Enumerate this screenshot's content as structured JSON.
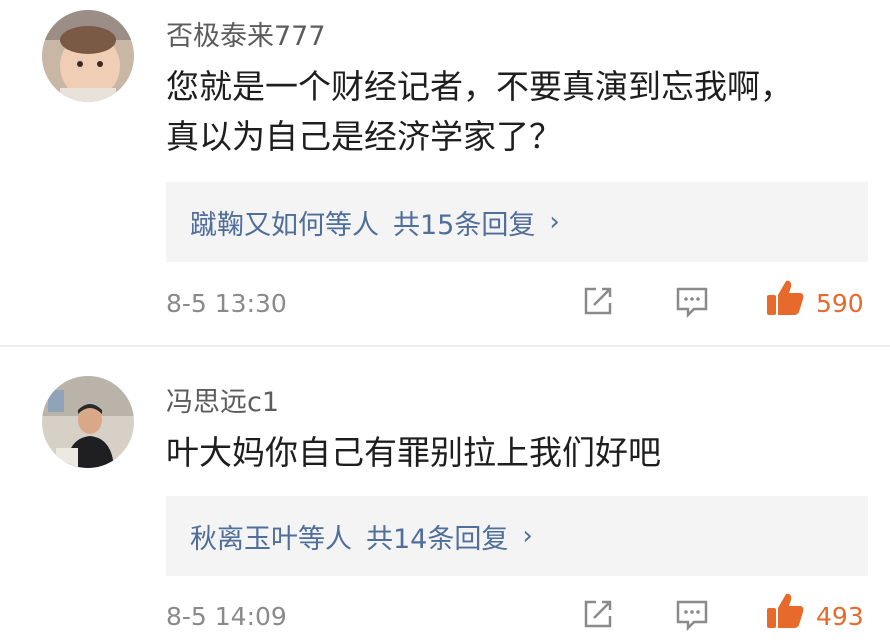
{
  "comments": [
    {
      "username": "否极泰来777",
      "text_line1": "您就是一个财经记者，不要真演到忘我啊，",
      "text_line2": "真以为自己是经济学家了？",
      "reply_names": "蹴鞠又如何等人",
      "reply_count": "共15条回复",
      "chevron": "›",
      "time": "8-5 13:30",
      "likes": "590"
    },
    {
      "username": "冯思远c1",
      "text_line1": "叶大妈你自己有罪别拉上我们好吧",
      "reply_names": "秋离玉叶等人",
      "reply_count": "共14条回复",
      "chevron": "›",
      "time": "8-5 14:09",
      "likes": "493"
    }
  ],
  "icons": {
    "share": "share-icon",
    "comment": "comment-icon",
    "like": "thumbs-up-icon"
  },
  "colors": {
    "link": "#4f6e9a",
    "like": "#e8692c",
    "reply_bg": "#f4f4f4"
  }
}
